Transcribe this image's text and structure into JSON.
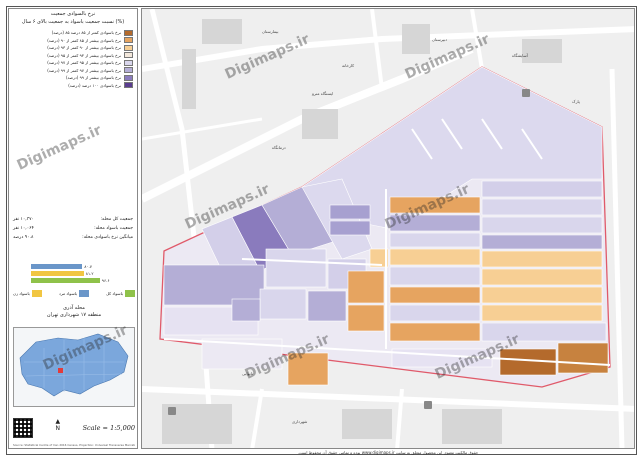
{
  "legend": {
    "title": "نرخ بالسوادی جمعیت",
    "subtitle": "نسبت جمعیت باسواد به جمعیت بالای ۶ سال (%)",
    "items": [
      {
        "label": "نرخ باسوادی کمتر از ۸۵ درصد ۸۵ (درصد)",
        "color": "#b46a2c"
      },
      {
        "label": "نرخ باسوادی بیشتر از ۸۵ کمتر از ۹۰ (درصد)",
        "color": "#e6a460"
      },
      {
        "label": "نرخ باسوادی بیشتر از ۹۰ کمتر از ۹۳ (درصد)",
        "color": "#f7cf94"
      },
      {
        "label": "نرخ باسوادی بیشتر از ۹۳ کمتر از ۹۵ (درصد)",
        "color": "#f3e8dc"
      },
      {
        "label": "نرخ باسوادی بیشتر از ۹۵ کمتر از ۹۷ (درصد)",
        "color": "#d9d6ec"
      },
      {
        "label": "نرخ باسوادی بیشتر از ۹۷ کمتر از ۹۹ (درصد)",
        "color": "#b4aed6"
      },
      {
        "label": "نرخ باسوادی بیشتر از ۹۹ (درصد)",
        "color": "#8a7bbd"
      },
      {
        "label": "نرخ باسوادی ۱۰۰ درصد (درصد)",
        "color": "#5a3d8f"
      }
    ]
  },
  "stats": [
    {
      "label": "جمعیت کل محله:",
      "value": "۱۰,۳۷۰ نفر"
    },
    {
      "label": "جمعیت باسواد محله:",
      "value": "۱۰,۰۶۴ نفر"
    },
    {
      "label": "میانگین نرخ باسوادی محله:",
      "value": "۹۰.۸ درصد"
    }
  ],
  "bars": [
    {
      "value": "۸۰.۷",
      "fraction": 0.64,
      "color": "#6a96c9"
    },
    {
      "value": "۸۱.۲",
      "fraction": 0.66,
      "color": "#f1c642"
    },
    {
      "value": "۹۶.۶",
      "fraction": 0.86,
      "color": "#8fc24a"
    }
  ],
  "categories": [
    {
      "label": "باسواد کل",
      "color": "#8fc24a"
    },
    {
      "label": "باسواد مرد",
      "color": "#6a96c9"
    },
    {
      "label": "باسواد زن",
      "color": "#f1c642"
    }
  ],
  "region": {
    "neighborhood": "محله آذری",
    "district": "منطقه ۱۷ شهرداری تهران"
  },
  "north_label": "N",
  "scale": "Scale = 1:5,000",
  "credit": "Source: Statistical Centre of Iran 2016 Census, Projection: Universal Transverse Mercator",
  "watermark": "Digimaps.ir",
  "map_labels": [
    {
      "text": "بیمارستان"
    },
    {
      "text": "دبیرستان"
    },
    {
      "text": "آسایشگاه"
    },
    {
      "text": "ایستگاه مترو"
    },
    {
      "text": "درمانگاه"
    },
    {
      "text": "پارک"
    },
    {
      "text": "کارخانه"
    },
    {
      "text": "نانوایی"
    },
    {
      "text": "شهرداری"
    }
  ],
  "bottom_note": "حقوق مالکیت معنوی این محصول متعلق به سایت www.digimaps.ir بوده و تمامی حقوق آن محفوظ است."
}
